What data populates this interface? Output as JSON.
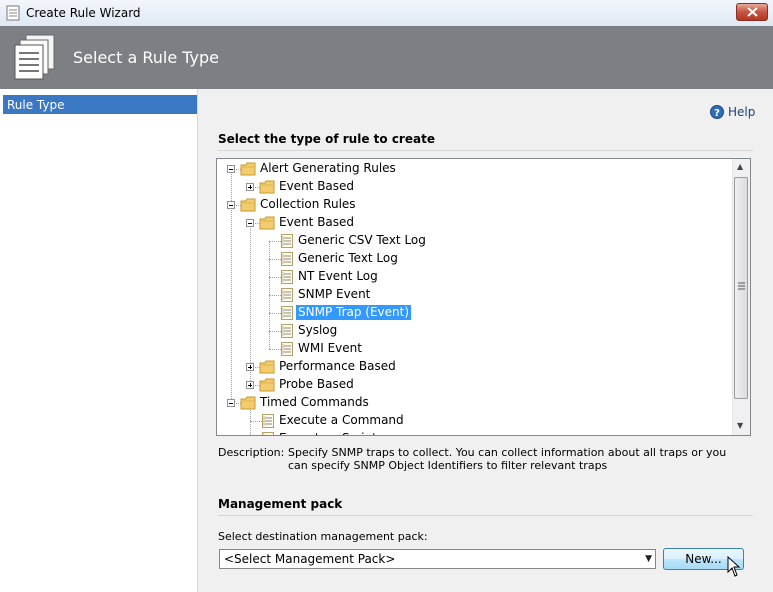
{
  "window": {
    "title": "Create Rule Wizard",
    "close_icon": "close-icon"
  },
  "header": {
    "heading": "Select a Rule Type",
    "icon": "document-stack-icon"
  },
  "nav": {
    "items": [
      {
        "label": "Rule Type",
        "selected": true
      }
    ]
  },
  "help": {
    "label": "Help",
    "icon": "help-icon"
  },
  "section_rule_type": {
    "title": "Select the type of rule to create"
  },
  "tree": {
    "nodes": [
      {
        "label": "Alert Generating Rules",
        "level": 0,
        "kind": "folder",
        "expanded": true
      },
      {
        "label": "Event Based",
        "level": 1,
        "kind": "folder",
        "expanded": false
      },
      {
        "label": "Collection Rules",
        "level": 0,
        "kind": "folder",
        "expanded": true
      },
      {
        "label": "Event Based",
        "level": 1,
        "kind": "folder",
        "expanded": true
      },
      {
        "label": "Generic CSV Text Log",
        "level": 2,
        "kind": "item"
      },
      {
        "label": "Generic Text Log",
        "level": 2,
        "kind": "item"
      },
      {
        "label": "NT Event Log",
        "level": 2,
        "kind": "item"
      },
      {
        "label": "SNMP Event",
        "level": 2,
        "kind": "item"
      },
      {
        "label": "SNMP Trap (Event)",
        "level": 2,
        "kind": "item",
        "selected": true
      },
      {
        "label": "Syslog",
        "level": 2,
        "kind": "item"
      },
      {
        "label": "WMI Event",
        "level": 2,
        "kind": "item"
      },
      {
        "label": "Performance Based",
        "level": 1,
        "kind": "folder",
        "expanded": false
      },
      {
        "label": "Probe Based",
        "level": 1,
        "kind": "folder",
        "expanded": false
      },
      {
        "label": "Timed Commands",
        "level": 0,
        "kind": "folder",
        "expanded": true
      },
      {
        "label": "Execute a Command",
        "level": 1,
        "kind": "item"
      },
      {
        "label": "Execute a Script",
        "level": 1,
        "kind": "item"
      }
    ]
  },
  "description": {
    "label": "Description:",
    "text": "Specify SNMP traps to collect. You can collect information about all traps or you can specify SNMP Object Identifiers to filter relevant traps"
  },
  "management_pack": {
    "title": "Management pack",
    "destination_label": "Select destination management pack:",
    "selected_value": "<Select Management Pack>",
    "new_button": "New..."
  },
  "colors": {
    "banner": "#7c7f84",
    "selection": "#3399ff",
    "nav_selection": "#3a78c4"
  }
}
